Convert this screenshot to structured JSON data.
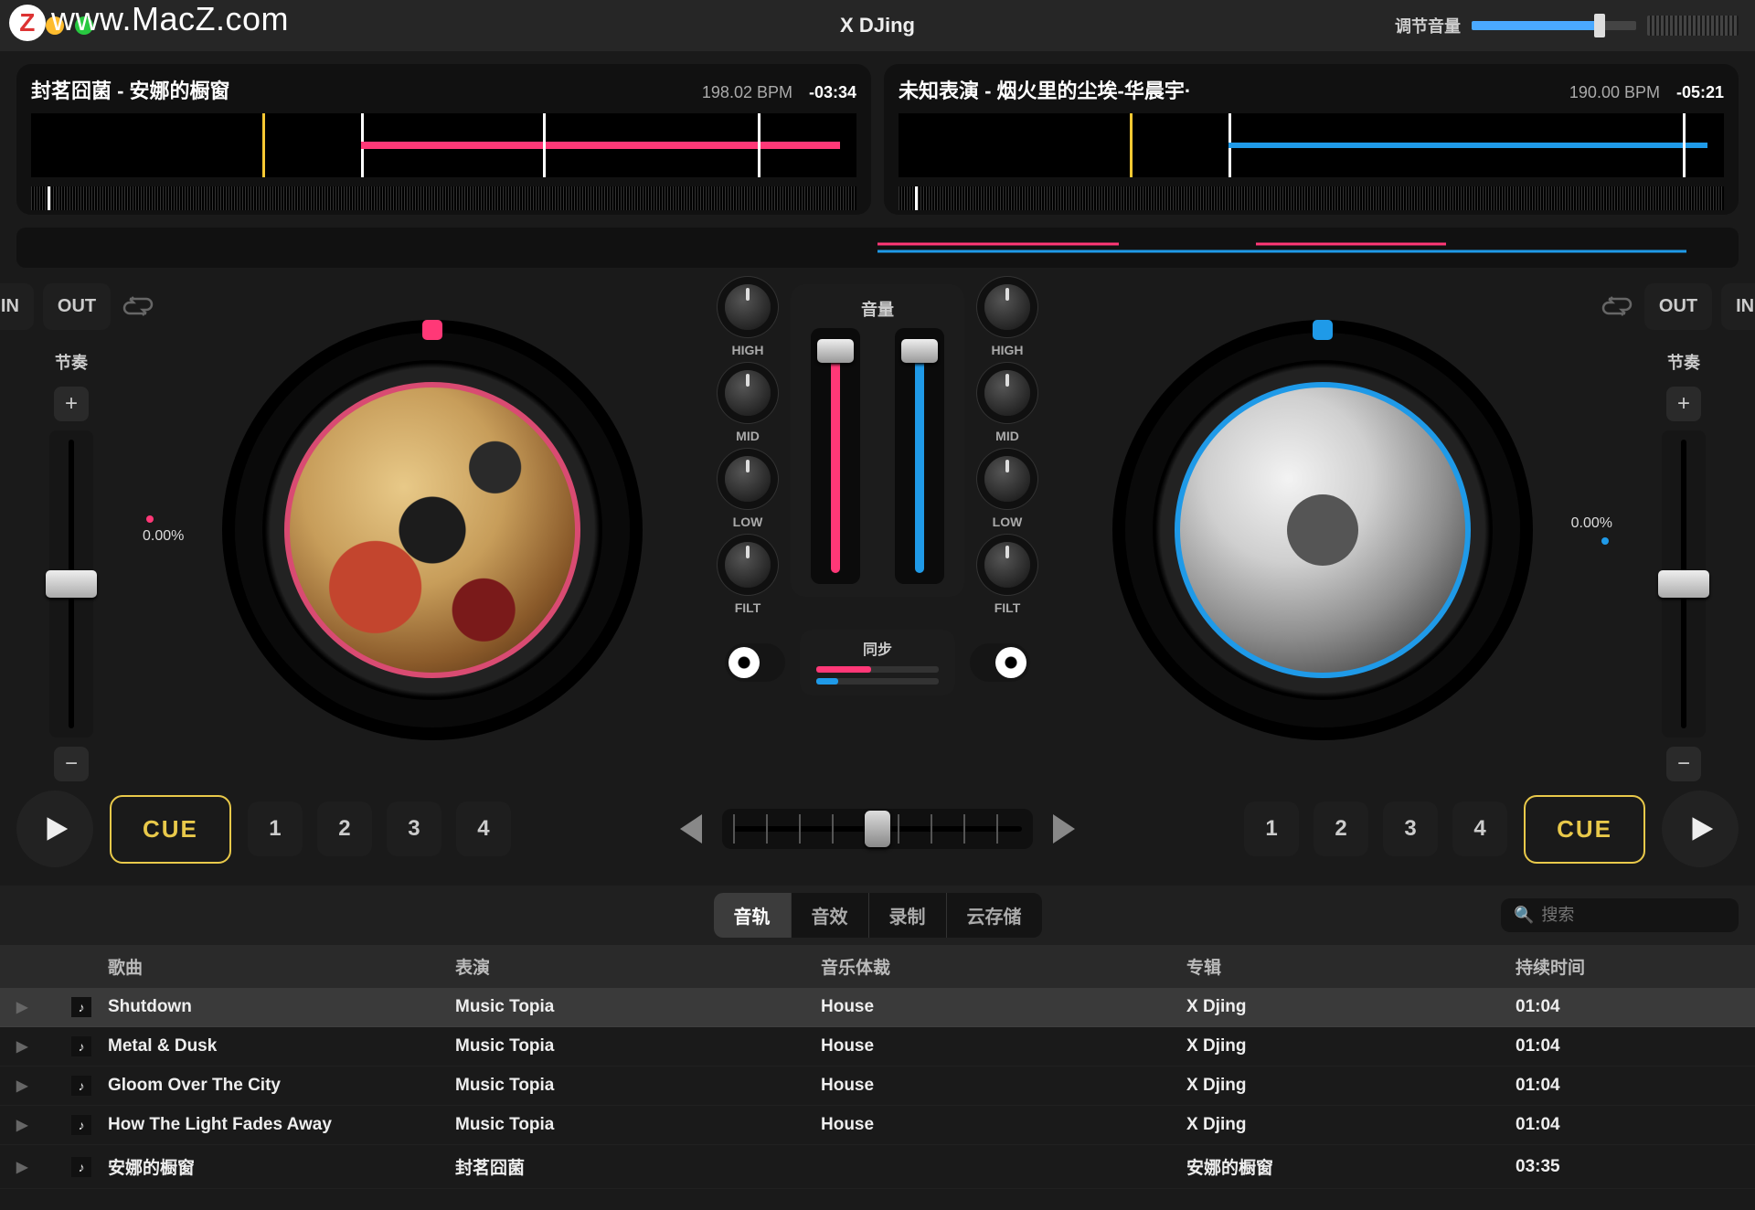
{
  "watermark": "www.MacZ.com",
  "app_title": "X DJing",
  "volume_label": "调节音量",
  "deck_a": {
    "title": "封茗囧菌 - 安娜的橱窗",
    "bpm": "198.02 BPM",
    "time": "-03:34",
    "tempo": "0.00%"
  },
  "deck_b": {
    "title": "未知表演 - 烟火里的尘埃-华晨宇·",
    "bpm": "190.00 BPM",
    "time": "-05:21",
    "tempo": "0.00%"
  },
  "loop": {
    "in": "IN",
    "out": "OUT"
  },
  "tempo_label": "节奏",
  "eq": {
    "high": "HIGH",
    "mid": "MID",
    "low": "LOW",
    "filt": "FILT"
  },
  "mixer": {
    "volume": "音量",
    "sync": "同步"
  },
  "cue": "CUE",
  "hotcues": [
    "1",
    "2",
    "3",
    "4"
  ],
  "tabs": [
    "音轨",
    "音效",
    "录制",
    "云存储"
  ],
  "search_placeholder": "搜索",
  "columns": {
    "song": "歌曲",
    "artist": "表演",
    "genre": "音乐体裁",
    "album": "专辑",
    "duration": "持续时间"
  },
  "tracks": [
    {
      "title": "Shutdown",
      "artist": "Music Topia",
      "genre": "House",
      "album": "X Djing",
      "duration": "01:04"
    },
    {
      "title": "Metal & Dusk",
      "artist": "Music Topia",
      "genre": "House",
      "album": "X Djing",
      "duration": "01:04"
    },
    {
      "title": "Gloom Over The City",
      "artist": "Music Topia",
      "genre": "House",
      "album": "X Djing",
      "duration": "01:04"
    },
    {
      "title": "How The Light Fades Away",
      "artist": "Music Topia",
      "genre": "House",
      "album": "X Djing",
      "duration": "01:04"
    },
    {
      "title": "安娜的橱窗",
      "artist": "封茗囧菌",
      "genre": "",
      "album": "安娜的橱窗",
      "duration": "03:35"
    }
  ]
}
